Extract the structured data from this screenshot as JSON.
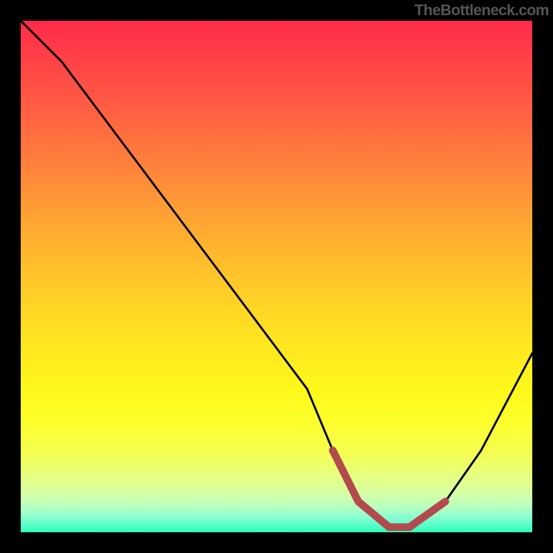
{
  "attribution": "TheBottleneck.com",
  "chart_data": {
    "type": "line",
    "title": "",
    "xlabel": "",
    "ylabel": "",
    "xlim": [
      0,
      100
    ],
    "ylim": [
      0,
      100
    ],
    "series": [
      {
        "name": "bottleneck-curve",
        "x": [
          0,
          8,
          20,
          32,
          44,
          56,
          61,
          66,
          72,
          76,
          83,
          90,
          100
        ],
        "values": [
          100,
          92,
          76,
          60,
          44,
          28,
          16,
          6,
          1,
          1,
          6,
          16,
          35
        ]
      }
    ],
    "highlights": [
      {
        "name": "optimal-range-marker",
        "color": "#b34a4e",
        "x": [
          61,
          66,
          72,
          76,
          83
        ],
        "values": [
          16,
          6,
          1,
          1,
          6
        ]
      }
    ]
  }
}
